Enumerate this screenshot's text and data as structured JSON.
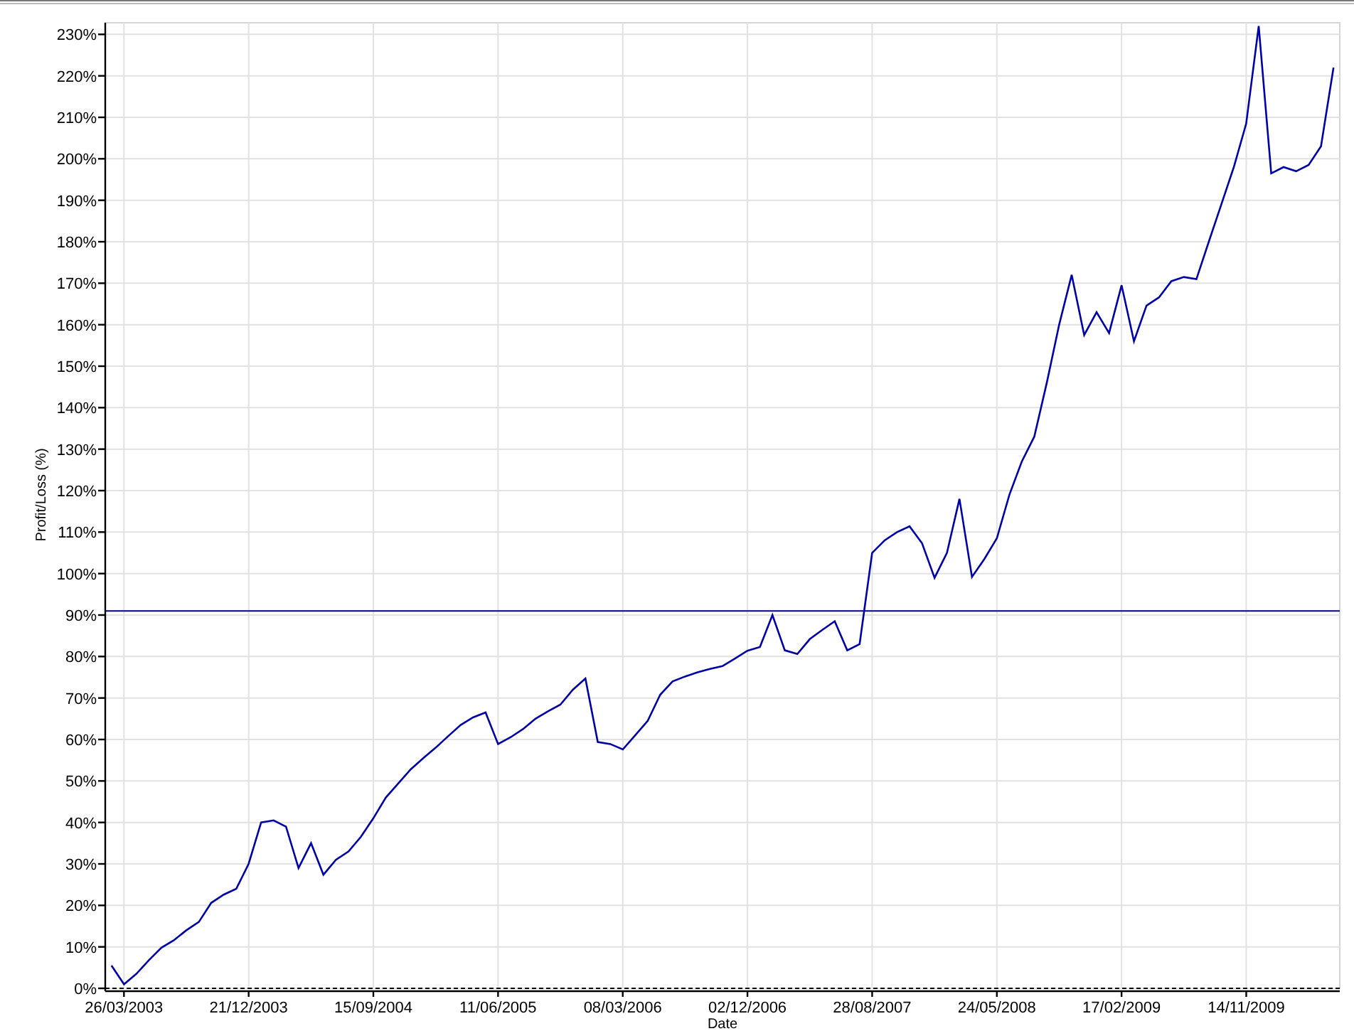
{
  "chart_data": {
    "type": "line",
    "xlabel": "Date",
    "ylabel": "Profit/Loss (%)",
    "ylim": [
      0,
      232.8
    ],
    "yticks": [
      {
        "value": 0,
        "label": "0%"
      },
      {
        "value": 10,
        "label": "10%"
      },
      {
        "value": 20,
        "label": "20%"
      },
      {
        "value": 30,
        "label": "30%"
      },
      {
        "value": 40,
        "label": "40%"
      },
      {
        "value": 50,
        "label": "50%"
      },
      {
        "value": 60,
        "label": "60%"
      },
      {
        "value": 70,
        "label": "70%"
      },
      {
        "value": 80,
        "label": "80%"
      },
      {
        "value": 90,
        "label": "90%"
      },
      {
        "value": 100,
        "label": "100%"
      },
      {
        "value": 110,
        "label": "110%"
      },
      {
        "value": 120,
        "label": "120%"
      },
      {
        "value": 130,
        "label": "130%"
      },
      {
        "value": 140,
        "label": "140%"
      },
      {
        "value": 150,
        "label": "150%"
      },
      {
        "value": 160,
        "label": "160%"
      },
      {
        "value": 170,
        "label": "170%"
      },
      {
        "value": 180,
        "label": "180%"
      },
      {
        "value": 190,
        "label": "190%"
      },
      {
        "value": 200,
        "label": "200%"
      },
      {
        "value": 210,
        "label": "210%"
      },
      {
        "value": 220,
        "label": "220%"
      },
      {
        "value": 230,
        "label": "230%"
      }
    ],
    "categories": [
      null,
      "26/03/2003",
      null,
      null,
      null,
      null,
      null,
      null,
      null,
      null,
      null,
      "21/12/2003",
      null,
      null,
      null,
      null,
      null,
      null,
      null,
      null,
      null,
      "15/09/2004",
      null,
      null,
      null,
      null,
      null,
      null,
      null,
      null,
      null,
      "11/06/2005",
      null,
      null,
      null,
      null,
      null,
      null,
      null,
      null,
      null,
      "08/03/2006",
      null,
      null,
      null,
      null,
      null,
      null,
      null,
      null,
      null,
      "02/12/2006",
      null,
      null,
      null,
      null,
      null,
      null,
      null,
      null,
      null,
      "28/08/2007",
      null,
      null,
      null,
      null,
      null,
      null,
      null,
      null,
      null,
      "24/05/2008",
      null,
      null,
      null,
      null,
      null,
      null,
      null,
      null,
      null,
      "17/02/2009",
      null,
      null,
      null,
      null,
      null,
      null,
      null,
      null,
      null,
      "14/11/2009",
      null,
      null,
      null,
      null,
      null,
      null,
      null
    ],
    "series": [
      {
        "color": "#0000a8",
        "values": [
          5.5,
          1,
          3.5,
          6.8,
          9.8,
          11.6,
          14,
          16,
          20.6,
          22.6,
          24,
          30,
          40,
          40.5,
          39,
          29,
          35,
          27.4,
          31,
          33,
          36.5,
          41,
          46,
          49.4,
          52.8,
          55.5,
          58,
          60.8,
          63.5,
          65.3,
          66.5,
          58.9,
          60.5,
          62.5,
          65,
          66.8,
          68.4,
          72,
          74.7,
          59.4,
          58.9,
          57.6,
          61,
          64.5,
          70.8,
          74,
          75.2,
          76.2,
          77,
          77.7,
          79.5,
          81.4,
          82.3,
          90,
          81.5,
          80.6,
          84.2,
          86.4,
          88.5,
          81.5,
          83,
          105,
          108,
          110,
          111.4,
          107.3,
          99,
          105,
          118,
          99.2,
          103.5,
          108.5,
          119,
          127,
          133,
          146,
          160,
          172,
          157.5,
          163,
          158,
          169.5,
          156,
          164.6,
          166.6,
          170.5,
          171.5,
          171,
          180,
          189,
          198,
          208.5,
          232,
          196.5,
          198,
          197,
          198.5,
          203,
          222
        ]
      }
    ],
    "grid": true,
    "ref_lines": [
      {
        "axis": "y",
        "value": 91,
        "color": "#000080"
      }
    ]
  }
}
